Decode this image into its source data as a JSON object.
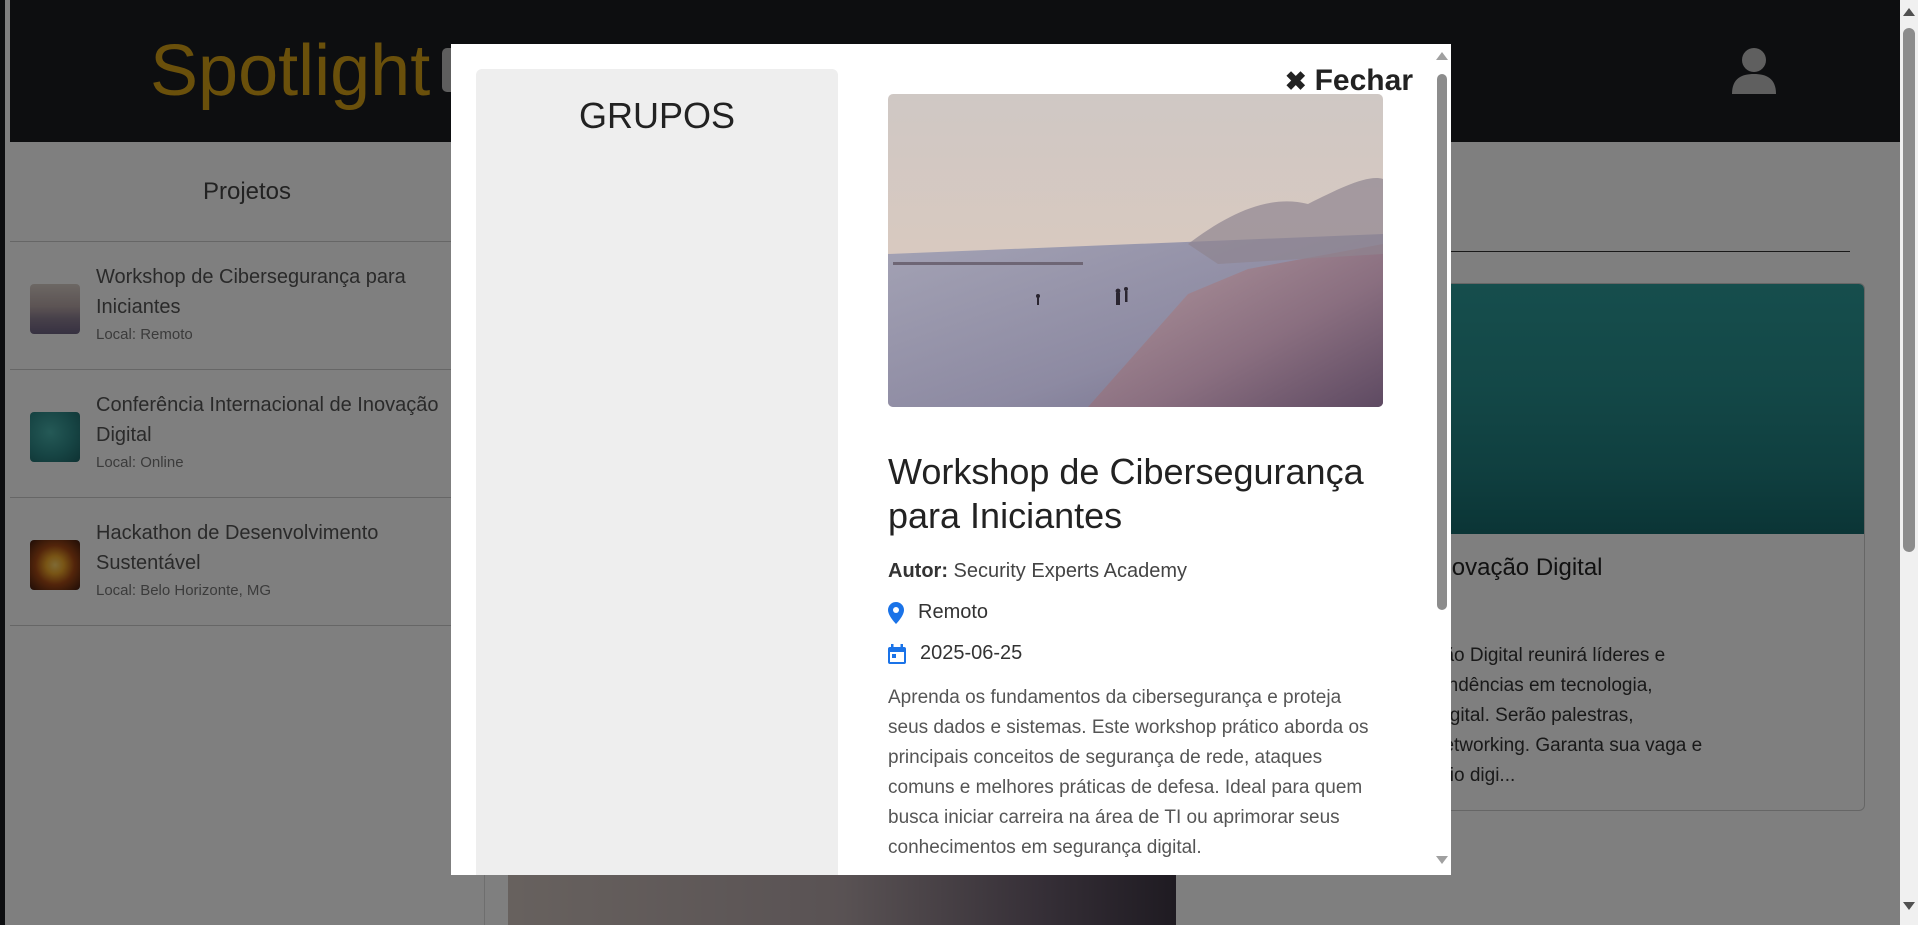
{
  "header": {
    "logo_text": "Spotlight",
    "user_icon": "user-icon"
  },
  "sidebar": {
    "title": "Projetos",
    "items": [
      {
        "name": "Workshop de Cibersegurança para Iniciantes",
        "location": "Local: Remoto"
      },
      {
        "name": "Conferência Internacional de Inovação Digital",
        "location": "Local: Online"
      },
      {
        "name": "Hackathon de Desenvolvimento Sustentável",
        "location": "Local: Belo Horizonte, MG"
      }
    ]
  },
  "background_card": {
    "title_visible": "ional de Inovação Digital",
    "desc_lines": [
      "al de Inovação Digital reunirá líderes e",
      "as últimas tendências em tecnologia,",
      "sformação digital. Serão palestras,",
      "essões de networking. Garanta sua vaga e",
      "ças no cenário digi..."
    ]
  },
  "modal": {
    "groups_title": "GRUPOS",
    "close_label": "Fechar",
    "close_icon": "close-icon",
    "project": {
      "title": "Workshop de Cibersegurança para Iniciantes",
      "author_label": "Autor:",
      "author": "Security Experts Academy",
      "location": "Remoto",
      "date": "2025-06-25",
      "location_icon": "map-pin-icon",
      "date_icon": "calendar-icon",
      "description": "Aprenda os fundamentos da cibersegurança e proteja seus dados e sistemas. Este workshop prático aborda os principais conceitos de segurança de rede, ataques comuns e melhores práticas de defesa. Ideal para quem busca iniciar carreira na área de TI ou aprimorar seus conhecimentos em segurança digital."
    }
  },
  "colors": {
    "brand": "#d4a017",
    "header_bg": "#1a1c20",
    "icon_blue": "#1a73e8"
  }
}
